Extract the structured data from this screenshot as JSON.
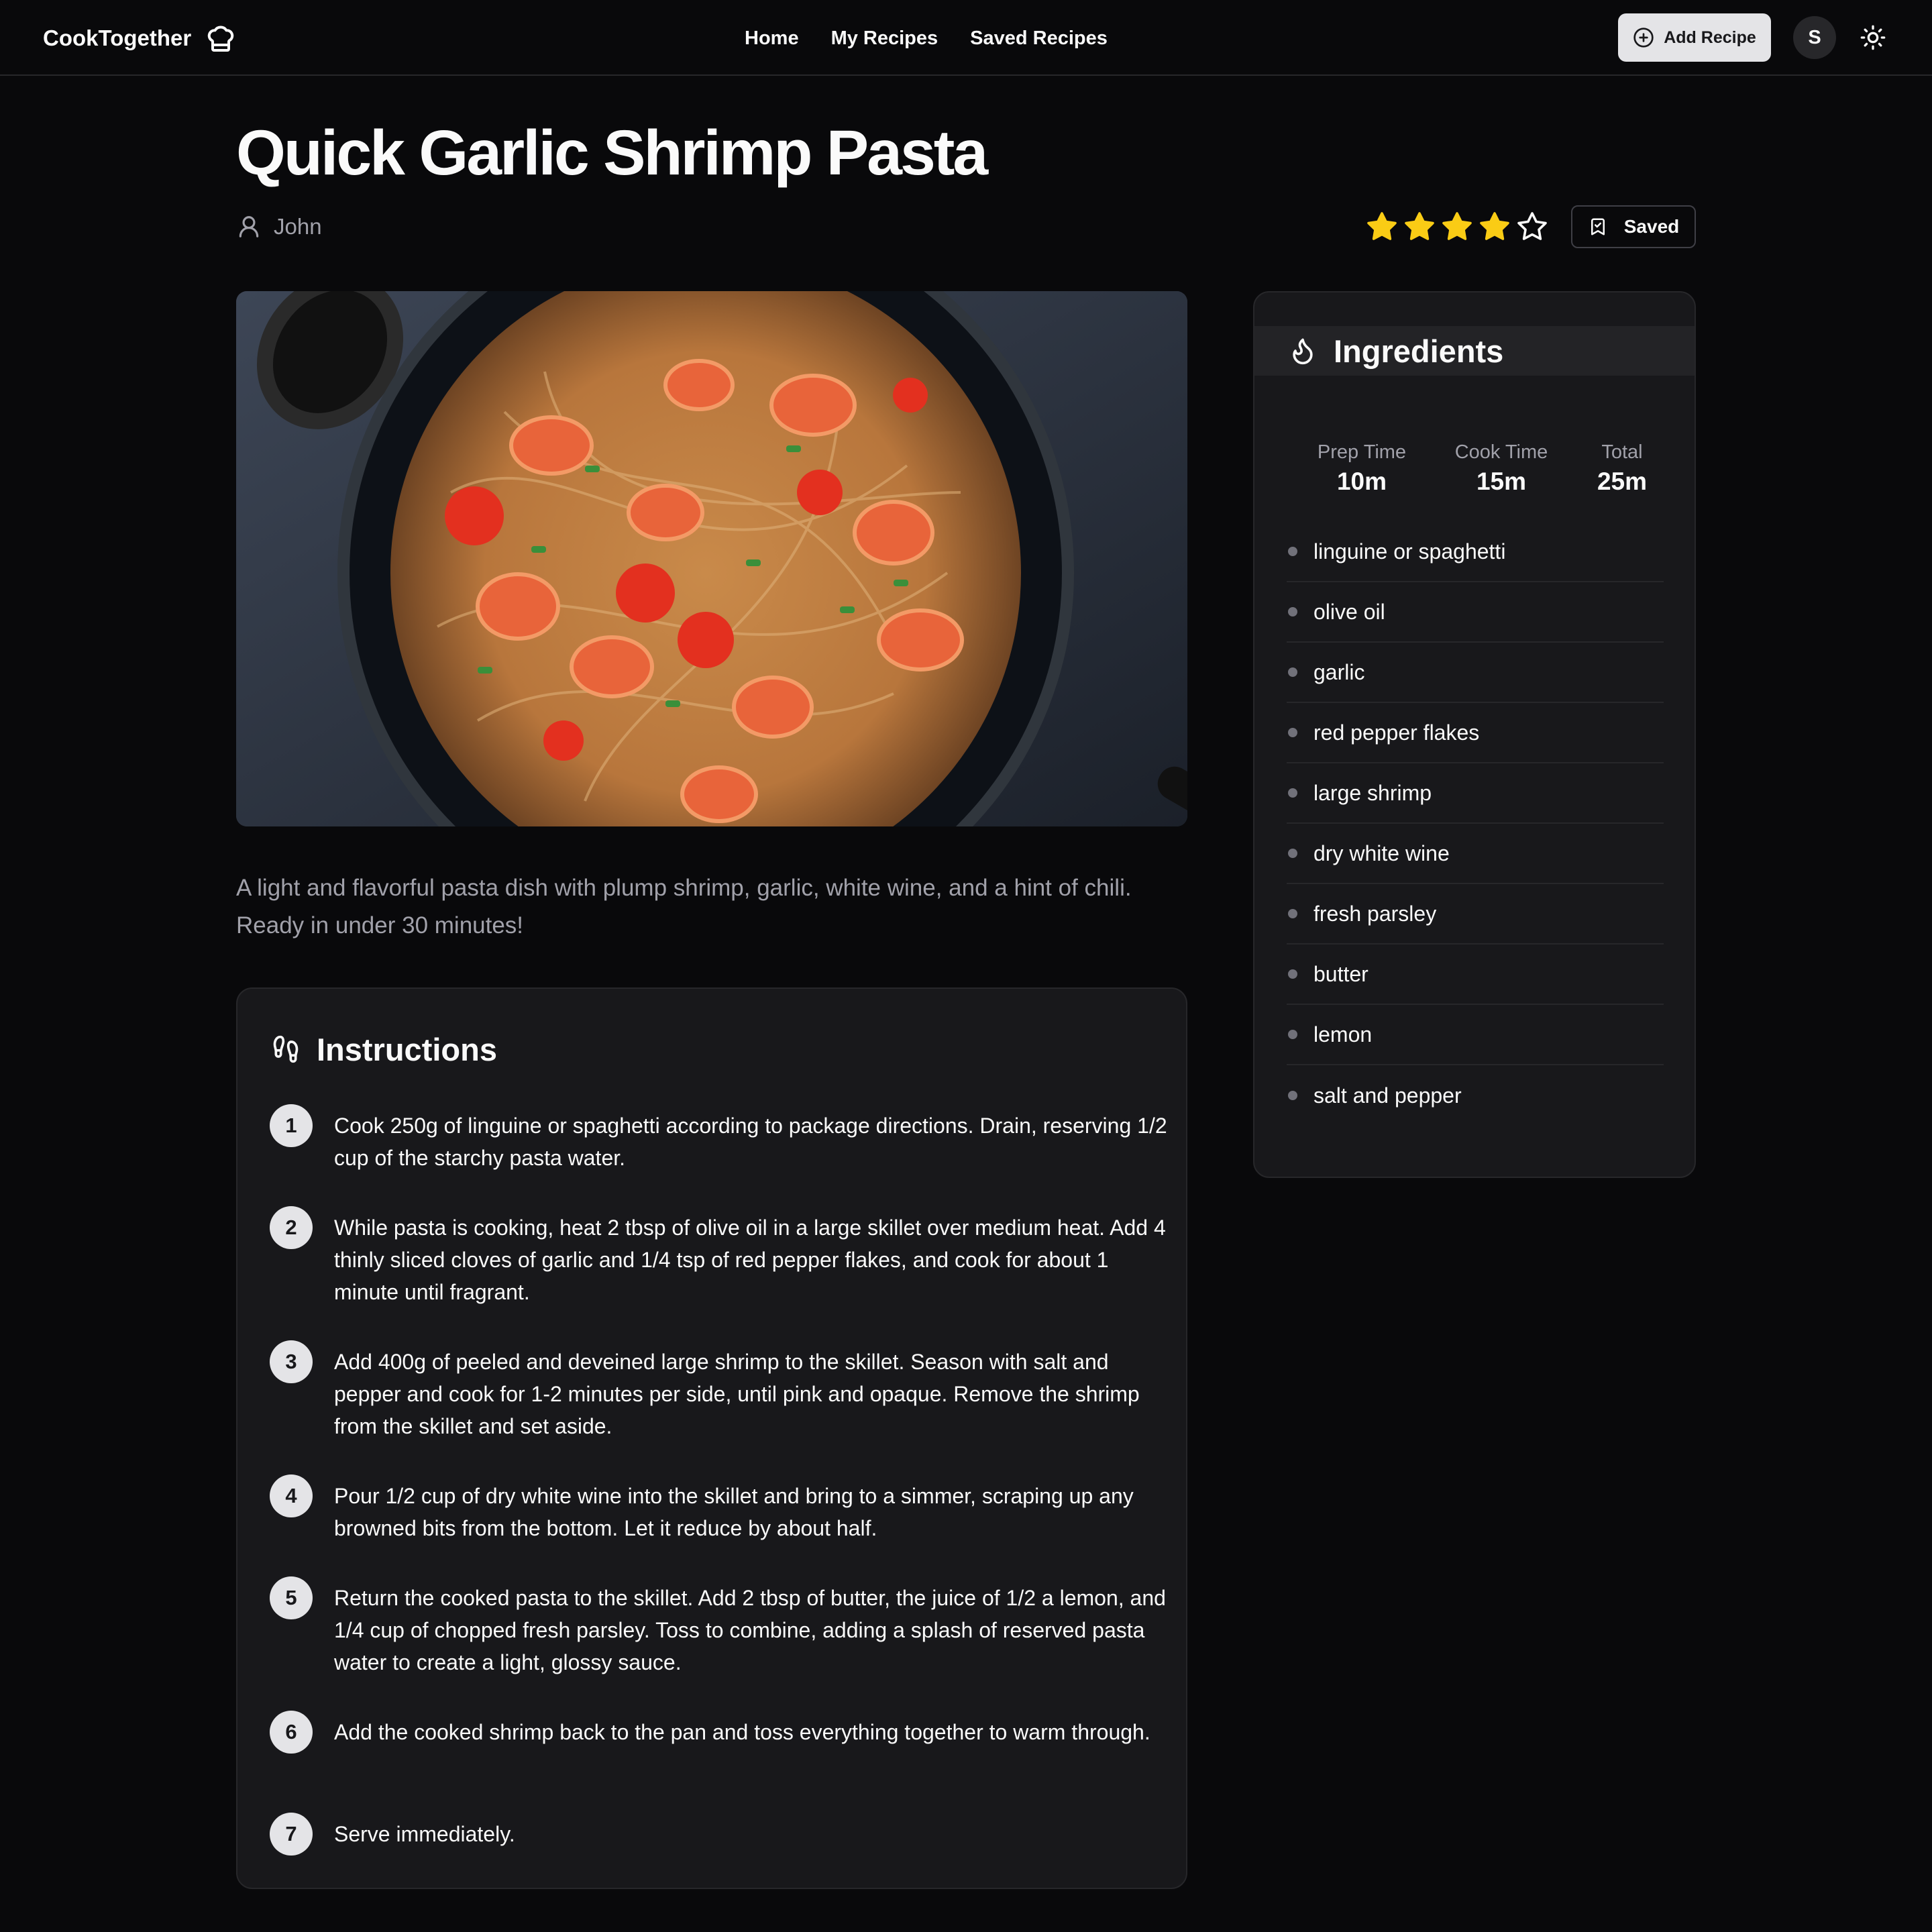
{
  "nav": {
    "brand": "CookTogether",
    "links": [
      "Home",
      "My Recipes",
      "Saved Recipes"
    ],
    "add_recipe_label": "Add Recipe",
    "avatar_initial": "S"
  },
  "recipe": {
    "title": "Quick Garlic Shrimp Pasta",
    "author": "John",
    "rating": 4,
    "rating_max": 5,
    "saved_label": "Saved",
    "description": "A light and flavorful pasta dish with plump shrimp, garlic, white wine, and a hint of chili. Ready in under 30 minutes!"
  },
  "instructions": {
    "heading": "Instructions",
    "steps": [
      {
        "num": "1",
        "text": "Cook 250g of linguine or spaghetti according to package directions. Drain, reserving 1/2 cup of the starchy pasta water."
      },
      {
        "num": "2",
        "text": "While pasta is cooking, heat 2 tbsp of olive oil in a large skillet over medium heat. Add 4 thinly sliced cloves of garlic and 1/4 tsp of red pepper flakes, and cook for about 1 minute until fragrant."
      },
      {
        "num": "3",
        "text": "Add 400g of peeled and deveined large shrimp to the skillet. Season with salt and pepper and cook for 1-2 minutes per side, until pink and opaque. Remove the shrimp from the skillet and set aside."
      },
      {
        "num": "4",
        "text": "Pour 1/2 cup of dry white wine into the skillet and bring to a simmer, scraping up any browned bits from the bottom. Let it reduce by about half."
      },
      {
        "num": "5",
        "text": "Return the cooked pasta to the skillet. Add 2 tbsp of butter, the juice of 1/2 a lemon, and 1/4 cup of chopped fresh parsley. Toss to combine, adding a splash of reserved pasta water to create a light, glossy sauce."
      },
      {
        "num": "6",
        "text": "Add the cooked shrimp back to the pan and toss everything together to warm through."
      },
      {
        "num": "7",
        "text": "Serve immediately."
      }
    ]
  },
  "ingredients": {
    "heading": "Ingredients",
    "times": [
      {
        "label": "Prep Time",
        "value": "10m"
      },
      {
        "label": "Cook Time",
        "value": "15m"
      },
      {
        "label": "Total",
        "value": "25m"
      }
    ],
    "items": [
      "linguine or spaghetti",
      "olive oil",
      "garlic",
      "red pepper flakes",
      "large shrimp",
      "dry white wine",
      "fresh parsley",
      "butter",
      "lemon",
      "salt and pepper"
    ]
  },
  "colors": {
    "background": "#09090b",
    "card": "#18181b",
    "border": "#27272a",
    "star": "#facc15",
    "muted_text": "#a1a1aa"
  },
  "icons": {
    "brand": "chef-hat-icon",
    "add": "plus-circle-icon",
    "theme": "sun-icon",
    "author": "user-icon",
    "saved": "bookmark-icon",
    "instructions": "footprints-icon",
    "ingredients": "flame-icon"
  }
}
